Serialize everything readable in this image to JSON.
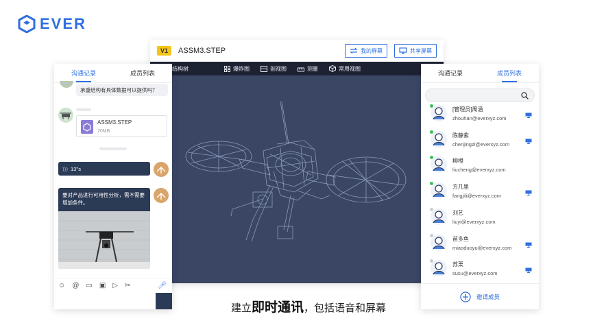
{
  "brand": {
    "name": "EVER",
    "color": "#2f6fe0"
  },
  "viewer": {
    "version_badge": "V1",
    "file_name": "ASSM3.STEP",
    "my_screen_label": "我的屏幕",
    "share_screen_label": "共享屏幕",
    "toolbar": {
      "structure_tree": "结构树",
      "explode_view": "爆炸图",
      "section_view": "剖视图",
      "measure": "测量",
      "common_views": "常用视图"
    }
  },
  "chat": {
    "tabs": [
      "沟通记录",
      "成员列表"
    ],
    "message_question": "承重结构有具体数据可以提供吗？",
    "file_name": "ASSM3.STEP",
    "file_size": "20MB",
    "voice_duration": "13''s",
    "message_request": "要对产品进行可用性分析，需不需要增加条件。"
  },
  "members_panel": {
    "tabs": [
      "沟通记录",
      "成员列表"
    ],
    "invite_label": "邀请成员",
    "members": [
      {
        "name": "[管理员]周涵",
        "email": "zhouhan@everxyz.com",
        "online": true,
        "sharing": true
      },
      {
        "name": "陈静紫",
        "email": "chenjingzi@everxyz.com",
        "online": true,
        "sharing": true
      },
      {
        "name": "柳橙",
        "email": "liucheng@everxyz.com",
        "online": true,
        "sharing": false
      },
      {
        "name": "方几里",
        "email": "fangjili@everxyz.com",
        "online": true,
        "sharing": true
      },
      {
        "name": "刘艺",
        "email": "liuyi@everxyz.com",
        "online": false,
        "sharing": false
      },
      {
        "name": "苗多鱼",
        "email": "miaoduoyu@everxyz.com",
        "online": false,
        "sharing": true
      },
      {
        "name": "苏栗",
        "email": "susu@everxyz.com",
        "online": false,
        "sharing": true
      }
    ]
  },
  "caption": {
    "prefix": "建立",
    "highlight": "即时通讯",
    "suffix": "，包括语音和屏幕"
  },
  "colors": {
    "accent": "#2f6fe0",
    "online": "#3cc25a",
    "offline": "#c9cdd4",
    "viewer_bg": "#3a4664",
    "toolbar_bg": "#1d2233"
  }
}
